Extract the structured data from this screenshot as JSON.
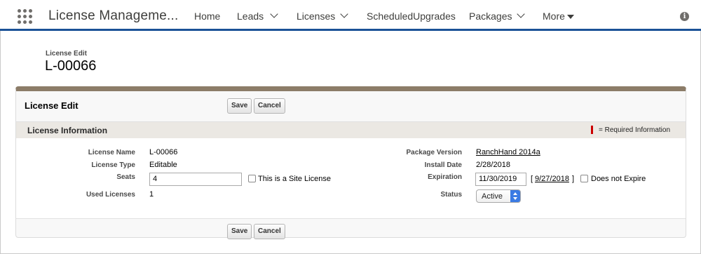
{
  "nav": {
    "app_name": "License Manageme...",
    "items": [
      "Home",
      "Leads",
      "Licenses",
      "ScheduledUpgrades",
      "Packages",
      "More"
    ]
  },
  "header": {
    "subtitle": "License Edit",
    "title": "L-00066"
  },
  "edit": {
    "title": "License Edit",
    "save_label": "Save",
    "cancel_label": "Cancel"
  },
  "section": {
    "title": "License Information",
    "required_text": "= Required Information"
  },
  "fields": {
    "license_name_label": "License Name",
    "license_name": "L-00066",
    "license_type_label": "License Type",
    "license_type": "Editable",
    "seats_label": "Seats",
    "seats": "4",
    "site_license_label": "This is a Site License",
    "used_licenses_label": "Used Licenses",
    "used_licenses": "1",
    "package_version_label": "Package Version",
    "package_version": "RanchHand 2014a",
    "install_date_label": "Install Date",
    "install_date": "2/28/2018",
    "expiration_label": "Expiration",
    "expiration": "11/30/2019",
    "expiration_today_open": "[",
    "expiration_today": "9/27/2018",
    "expiration_today_close": "]",
    "does_not_expire_label": "Does not Expire",
    "status_label": "Status",
    "status": "Active"
  },
  "colors": {
    "nav_accent": "#1b5297",
    "block_header": "#8c7c68",
    "section_bar": "#ebe8e3",
    "required": "#cc0000",
    "select_accent": "#3b7be4"
  }
}
